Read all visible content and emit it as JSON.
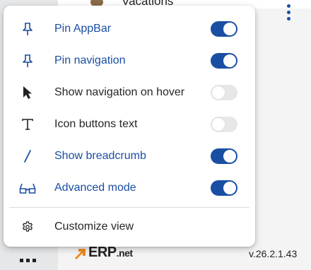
{
  "background": {
    "title": "Vacations",
    "version": "v.26.2.1.43",
    "logo": {
      "erp": "ERP",
      "net": ".net"
    }
  },
  "menu": {
    "items": [
      {
        "label": "Pin AppBar",
        "icon": "pin-icon",
        "active": true,
        "toggle": "on"
      },
      {
        "label": "Pin navigation",
        "icon": "pin-icon",
        "active": true,
        "toggle": "on"
      },
      {
        "label": "Show navigation on hover",
        "icon": "cursor-arrow-icon",
        "active": false,
        "toggle": "off"
      },
      {
        "label": "Icon buttons text",
        "icon": "text-icon",
        "active": false,
        "toggle": "off"
      },
      {
        "label": "Show breadcrumb",
        "icon": "slash-icon",
        "active": true,
        "toggle": "on"
      },
      {
        "label": "Advanced mode",
        "icon": "glasses-icon",
        "active": true,
        "toggle": "on"
      }
    ],
    "customize": {
      "label": "Customize view",
      "icon": "gear-icon"
    }
  },
  "colors": {
    "accent": "#1a4ea2",
    "text": "#262626",
    "toggle_off": "#e7e7e7",
    "logo_orange": "#f08a1c"
  }
}
